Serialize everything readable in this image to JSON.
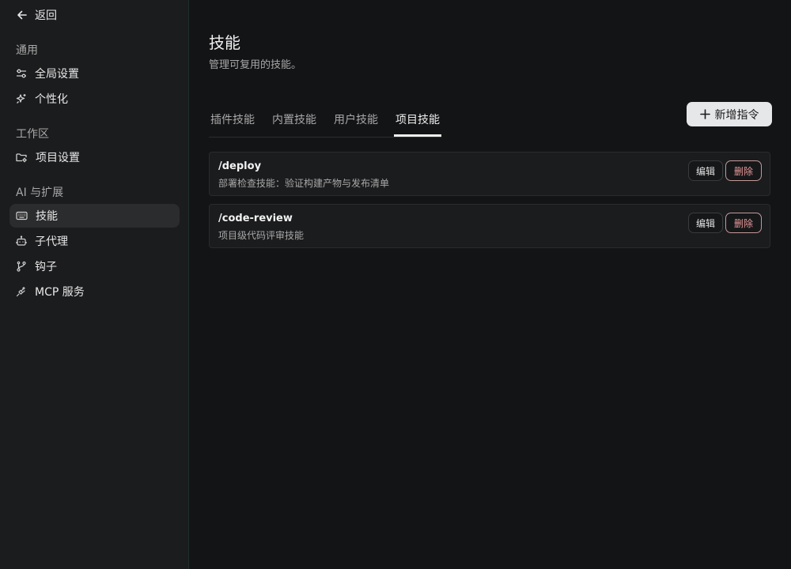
{
  "sidebar": {
    "back_label": "返回",
    "groups": [
      {
        "title": "通用",
        "items": [
          {
            "label": "全局设置",
            "icon": "sliders-icon"
          },
          {
            "label": "个性化",
            "icon": "sparkle-icon"
          }
        ]
      },
      {
        "title": "工作区",
        "items": [
          {
            "label": "项目设置",
            "icon": "folder-settings-icon"
          }
        ]
      },
      {
        "title": "AI 与扩展",
        "items": [
          {
            "label": "技能",
            "icon": "keyboard-icon",
            "active": true
          },
          {
            "label": "子代理",
            "icon": "bot-icon"
          },
          {
            "label": "钩子",
            "icon": "git-branch-icon"
          },
          {
            "label": "MCP 服务",
            "icon": "plug-icon"
          }
        ]
      }
    ]
  },
  "main": {
    "title": "技能",
    "subtitle": "管理可复用的技能。",
    "tabs": [
      {
        "label": "插件技能"
      },
      {
        "label": "内置技能"
      },
      {
        "label": "用户技能"
      },
      {
        "label": "项目技能",
        "active": true
      }
    ],
    "new_button_label": "新增指令",
    "skills": [
      {
        "name": "/deploy",
        "description": "部署检查技能：验证构建产物与发布清单",
        "edit_label": "编辑",
        "delete_label": "删除"
      },
      {
        "name": "/code-review",
        "description": "项目级代码评审技能",
        "edit_label": "编辑",
        "delete_label": "删除"
      }
    ]
  },
  "colors": {
    "background": "#131416",
    "sidebar": "#1b1c1e",
    "danger": "#e79a9a",
    "primary_button": "#e6e7e9"
  }
}
